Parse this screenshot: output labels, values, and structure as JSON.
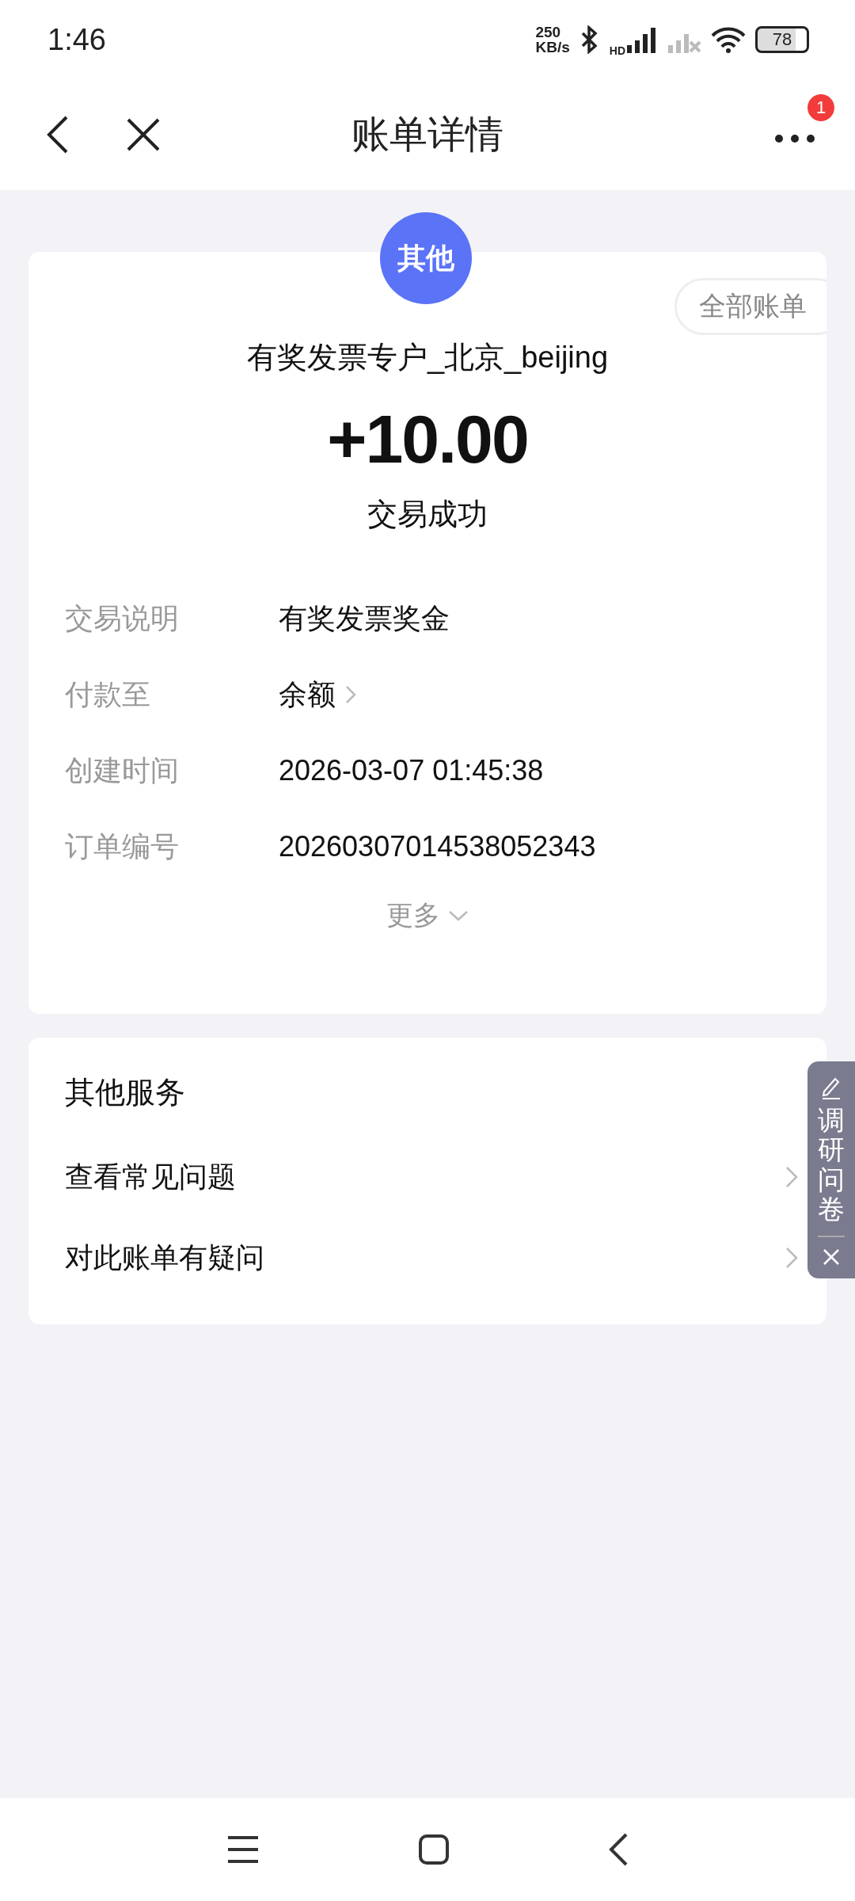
{
  "status_bar": {
    "time": "1:46",
    "net_speed": "250",
    "net_unit": "KB/s",
    "hd": "HD",
    "battery": "78"
  },
  "header": {
    "title": "账单详情",
    "badge": "1"
  },
  "bill": {
    "avatar": "其他",
    "all_bills": "全部账单",
    "merchant": "有奖发票专户_北京_beijing",
    "amount": "+10.00",
    "status": "交易成功",
    "details": [
      {
        "label": "交易说明",
        "value": "有奖发票奖金",
        "kind": "text"
      },
      {
        "label": "付款至",
        "value": "余额",
        "kind": "link"
      },
      {
        "label": "创建时间",
        "value": "2026-03-07 01:45:38",
        "kind": "text"
      },
      {
        "label": "订单编号",
        "value": "20260307014538052343",
        "kind": "text"
      }
    ],
    "more": "更多"
  },
  "services": {
    "title": "其他服务",
    "items": [
      {
        "label": "查看常见问题"
      },
      {
        "label": "对此账单有疑问"
      }
    ]
  },
  "survey": {
    "label": "调研问卷"
  }
}
